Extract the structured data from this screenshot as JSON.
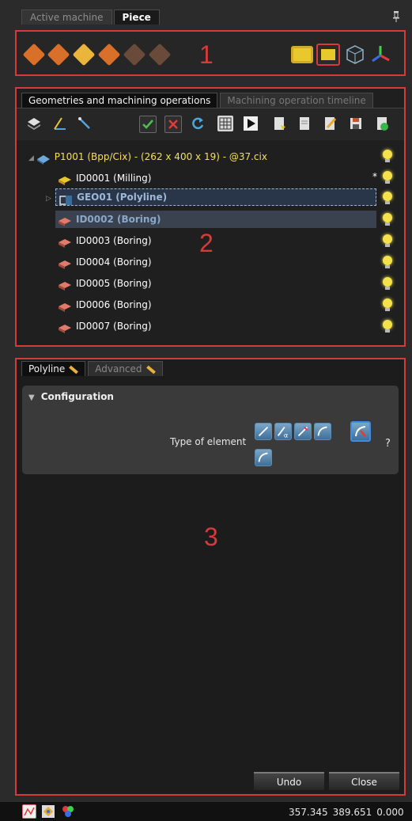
{
  "top_tabs": [
    "Active machine",
    "Piece"
  ],
  "section_labels": {
    "s1": "1",
    "s2": "2",
    "s3": "3"
  },
  "panel2": {
    "tabs": [
      "Geometries and machining operations",
      "Machining operation timeline"
    ],
    "tree": [
      {
        "label": "P1001 (Bpp/Cix) - (262 x 400 x 19) - @37.cix",
        "style": "root",
        "icon": "piece-icon",
        "expander": "◢",
        "marker": ""
      },
      {
        "label": "ID0001 (Milling)",
        "style": "normal",
        "icon": "milling-icon",
        "marker": "*"
      },
      {
        "label": "GEO01 (Polyline)",
        "style": "selected",
        "icon": "polyline-icon",
        "expander": "▷",
        "marker": ""
      },
      {
        "label": "ID0002 (Boring)",
        "style": "highlight",
        "icon": "boring-icon",
        "marker": ""
      },
      {
        "label": "ID0003 (Boring)",
        "style": "normal",
        "icon": "boring-icon",
        "marker": ""
      },
      {
        "label": "ID0004 (Boring)",
        "style": "normal",
        "icon": "boring-icon",
        "marker": ""
      },
      {
        "label": "ID0005 (Boring)",
        "style": "normal",
        "icon": "boring-icon",
        "marker": ""
      },
      {
        "label": "ID0006 (Boring)",
        "style": "normal",
        "icon": "boring-icon",
        "marker": ""
      },
      {
        "label": "ID0007 (Boring)",
        "style": "normal",
        "icon": "boring-icon",
        "marker": ""
      }
    ]
  },
  "panel3": {
    "tabs": [
      "Polyline",
      "Advanced"
    ],
    "config_title": "Configuration",
    "type_label": "Type of element",
    "help": "?",
    "undo": "Undo",
    "close": "Close"
  },
  "status": {
    "x": "357.345",
    "y": "389.651",
    "z": "0.000"
  },
  "colors": {
    "accent_red": "#d43b3b",
    "root_text": "#f5e14a",
    "selected_text": "#9fb8d6",
    "bulb": "#f5e14a",
    "element_button": "#5b8fb8"
  }
}
